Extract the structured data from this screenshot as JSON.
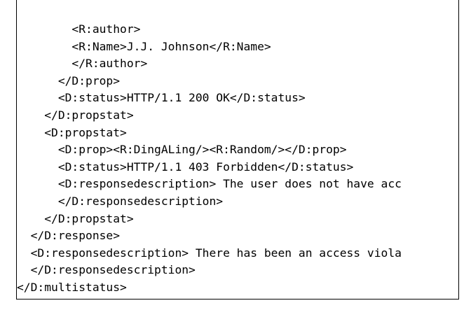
{
  "code": {
    "lines": [
      "        <R:author>",
      "        <R:Name>J.J. Johnson</R:Name>",
      "        </R:author>",
      "      </D:prop>",
      "      <D:status>HTTP/1.1 200 OK</D:status>",
      "    </D:propstat>",
      "    <D:propstat>",
      "      <D:prop><R:DingALing/><R:Random/></D:prop>",
      "      <D:status>HTTP/1.1 403 Forbidden</D:status>",
      "      <D:responsedescription> The user does not have acc",
      "      </D:responsedescription>",
      "    </D:propstat>",
      "  </D:response>",
      "  <D:responsedescription> There has been an access viola",
      "  </D:responsedescription>",
      "</D:multistatus>"
    ]
  }
}
